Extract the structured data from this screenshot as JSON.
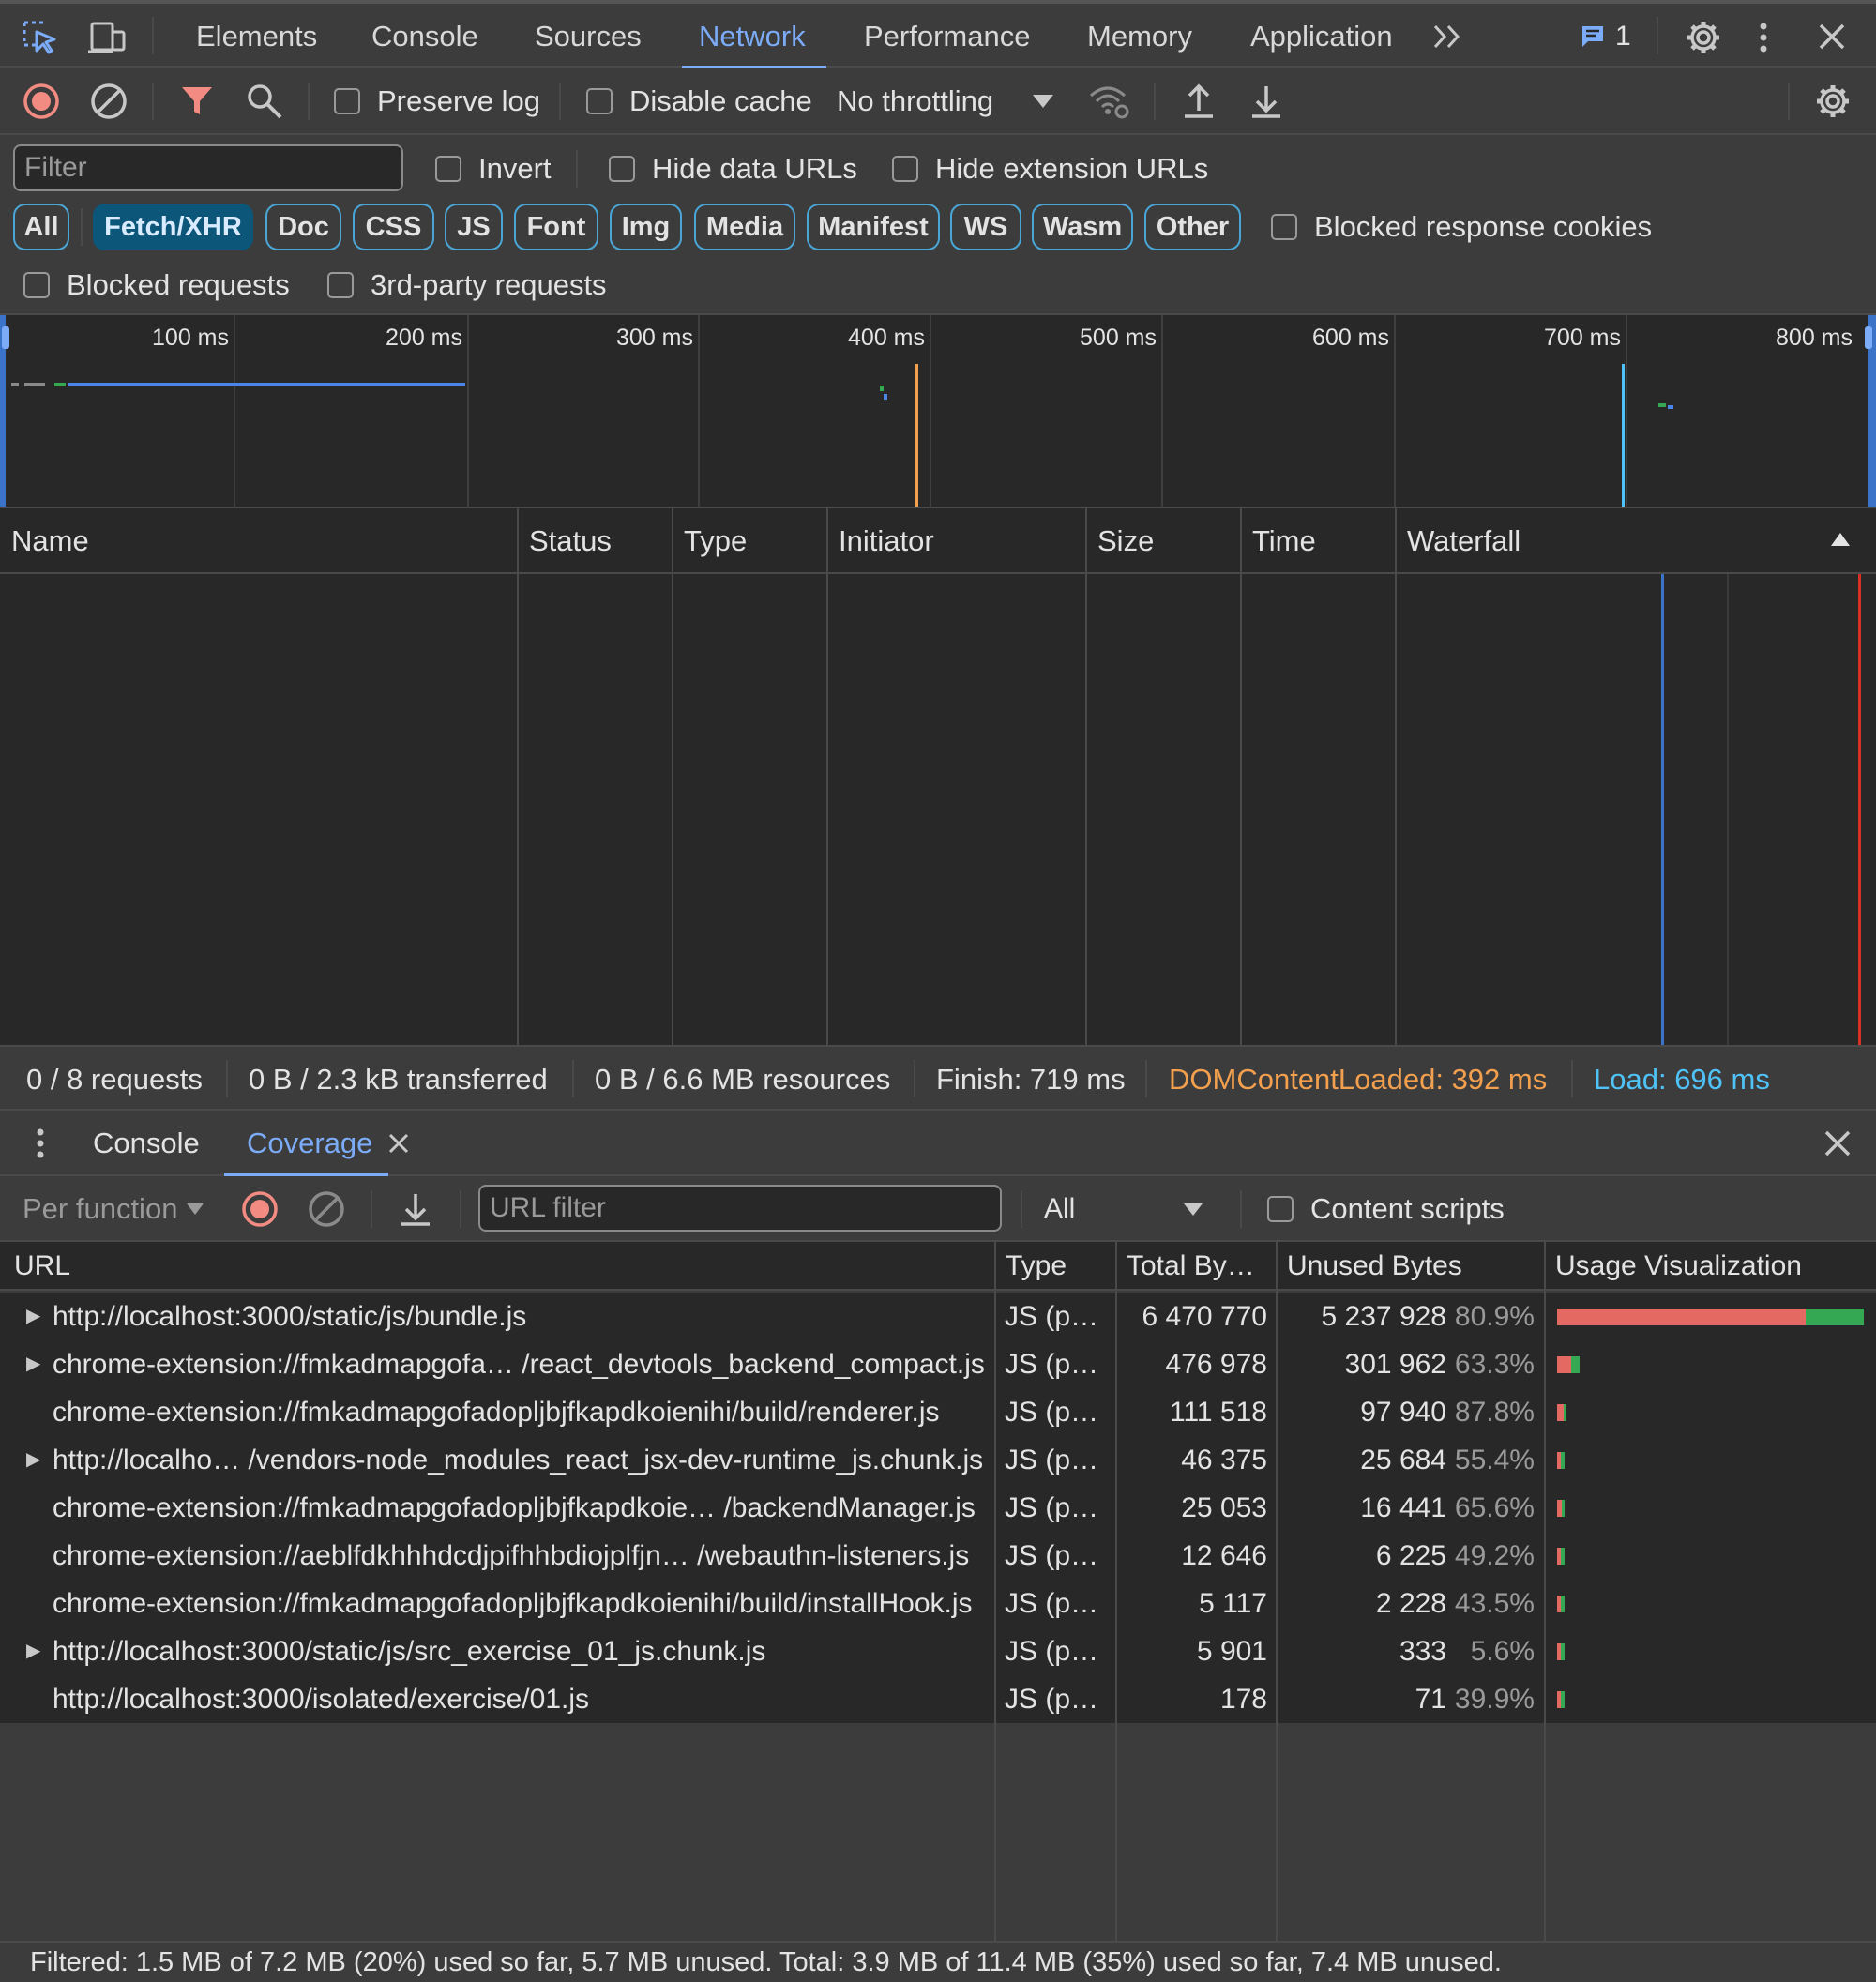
{
  "tabs": {
    "items": [
      "Elements",
      "Console",
      "Sources",
      "Network",
      "Performance",
      "Memory",
      "Application"
    ],
    "active": "Network",
    "more_icon": "double-chevron-right-icon",
    "issues_count": "1"
  },
  "toolbar": {
    "preserve_log": "Preserve log",
    "disable_cache": "Disable cache",
    "throttling": "No throttling"
  },
  "filter": {
    "placeholder": "Filter",
    "invert": "Invert",
    "hide_data_urls": "Hide data URLs",
    "hide_extension_urls": "Hide extension URLs",
    "chips": [
      "All",
      "Fetch/XHR",
      "Doc",
      "CSS",
      "JS",
      "Font",
      "Img",
      "Media",
      "Manifest",
      "WS",
      "Wasm",
      "Other"
    ],
    "active_chip": "Fetch/XHR",
    "blocked_response_cookies": "Blocked response cookies",
    "blocked_requests": "Blocked requests",
    "third_party": "3rd-party requests"
  },
  "overview": {
    "ticks": [
      "100 ms",
      "200 ms",
      "300 ms",
      "400 ms",
      "500 ms",
      "600 ms",
      "700 ms",
      "800 ms"
    ],
    "dcl_color": "#f29f4e",
    "load_color": "#4fc3f7"
  },
  "requests_table": {
    "columns": [
      "Name",
      "Status",
      "Type",
      "Initiator",
      "Size",
      "Time",
      "Waterfall"
    ]
  },
  "status": {
    "requests": "0 / 8 requests",
    "transferred": "0 B / 2.3 kB transferred",
    "resources": "0 B / 6.6 MB resources",
    "finish": "Finish: 719 ms",
    "dcl": "DOMContentLoaded: 392 ms",
    "load": "Load: 696 ms"
  },
  "drawer": {
    "tabs": [
      "Console",
      "Coverage"
    ],
    "active": "Coverage"
  },
  "coverage": {
    "mode": "Per function",
    "url_filter_placeholder": "URL filter",
    "type_filter": "All",
    "content_scripts": "Content scripts",
    "columns": [
      "URL",
      "Type",
      "Total By…",
      "Unused Bytes",
      "Usage Visualization"
    ],
    "rows": [
      {
        "expandable": true,
        "url": "http://localhost:3000/static/js/bundle.js",
        "type": "JS (p…",
        "total": "6 470 770",
        "unused": "5 237 928",
        "pct": "80.9%",
        "bar_fraction": 1.0,
        "unused_fraction": 0.809
      },
      {
        "expandable": true,
        "url": "chrome-extension://fmkadmapgofa… /react_devtools_backend_compact.js",
        "type": "JS (p…",
        "total": "476 978",
        "unused": "301 962",
        "pct": "63.3%",
        "bar_fraction": 0.074,
        "unused_fraction": 0.633
      },
      {
        "expandable": false,
        "url": "chrome-extension://fmkadmapgofadopljbjfkapdkoienihi/build/renderer.js",
        "type": "JS (p…",
        "total": "111 518",
        "unused": "97 940",
        "pct": "87.8%",
        "bar_fraction": 0.017,
        "unused_fraction": 0.878
      },
      {
        "expandable": true,
        "url": "http://localho… /vendors-node_modules_react_jsx-dev-runtime_js.chunk.js",
        "type": "JS (p…",
        "total": "46 375",
        "unused": "25 684",
        "pct": "55.4%",
        "bar_fraction": 0.007,
        "unused_fraction": 0.554
      },
      {
        "expandable": false,
        "url": "chrome-extension://fmkadmapgofadopljbjfkapdkoie… /backendManager.js",
        "type": "JS (p…",
        "total": "25 053",
        "unused": "16 441",
        "pct": "65.6%",
        "bar_fraction": 0.004,
        "unused_fraction": 0.656
      },
      {
        "expandable": false,
        "url": "chrome-extension://aeblfdkhhhdcdjpifhhbdiojplfjn… /webauthn-listeners.js",
        "type": "JS (p…",
        "total": "12 646",
        "unused": "6 225",
        "pct": "49.2%",
        "bar_fraction": 0.002,
        "unused_fraction": 0.492
      },
      {
        "expandable": false,
        "url": "chrome-extension://fmkadmapgofadopljbjfkapdkoienihi/build/installHook.js",
        "type": "JS (p…",
        "total": "5 117",
        "unused": "2 228",
        "pct": "43.5%",
        "bar_fraction": 0.001,
        "unused_fraction": 0.435
      },
      {
        "expandable": true,
        "url": "http://localhost:3000/static/js/src_exercise_01_js.chunk.js",
        "type": "JS (p…",
        "total": "5 901",
        "unused": "333",
        "pct": "5.6%",
        "bar_fraction": 0.001,
        "unused_fraction": 0.056
      },
      {
        "expandable": false,
        "url": "http://localhost:3000/isolated/exercise/01.js",
        "type": "JS (p…",
        "total": "178",
        "unused": "71",
        "pct": "39.9%",
        "bar_fraction": 0.0001,
        "unused_fraction": 0.399
      }
    ],
    "footer": "Filtered: 1.5 MB of 7.2 MB (20%) used so far, 5.7 MB unused. Total: 3.9 MB of 11.4 MB (35%) used so far, 7.4 MB unused.",
    "unused_color": "#e46962",
    "used_color": "#34a853"
  }
}
